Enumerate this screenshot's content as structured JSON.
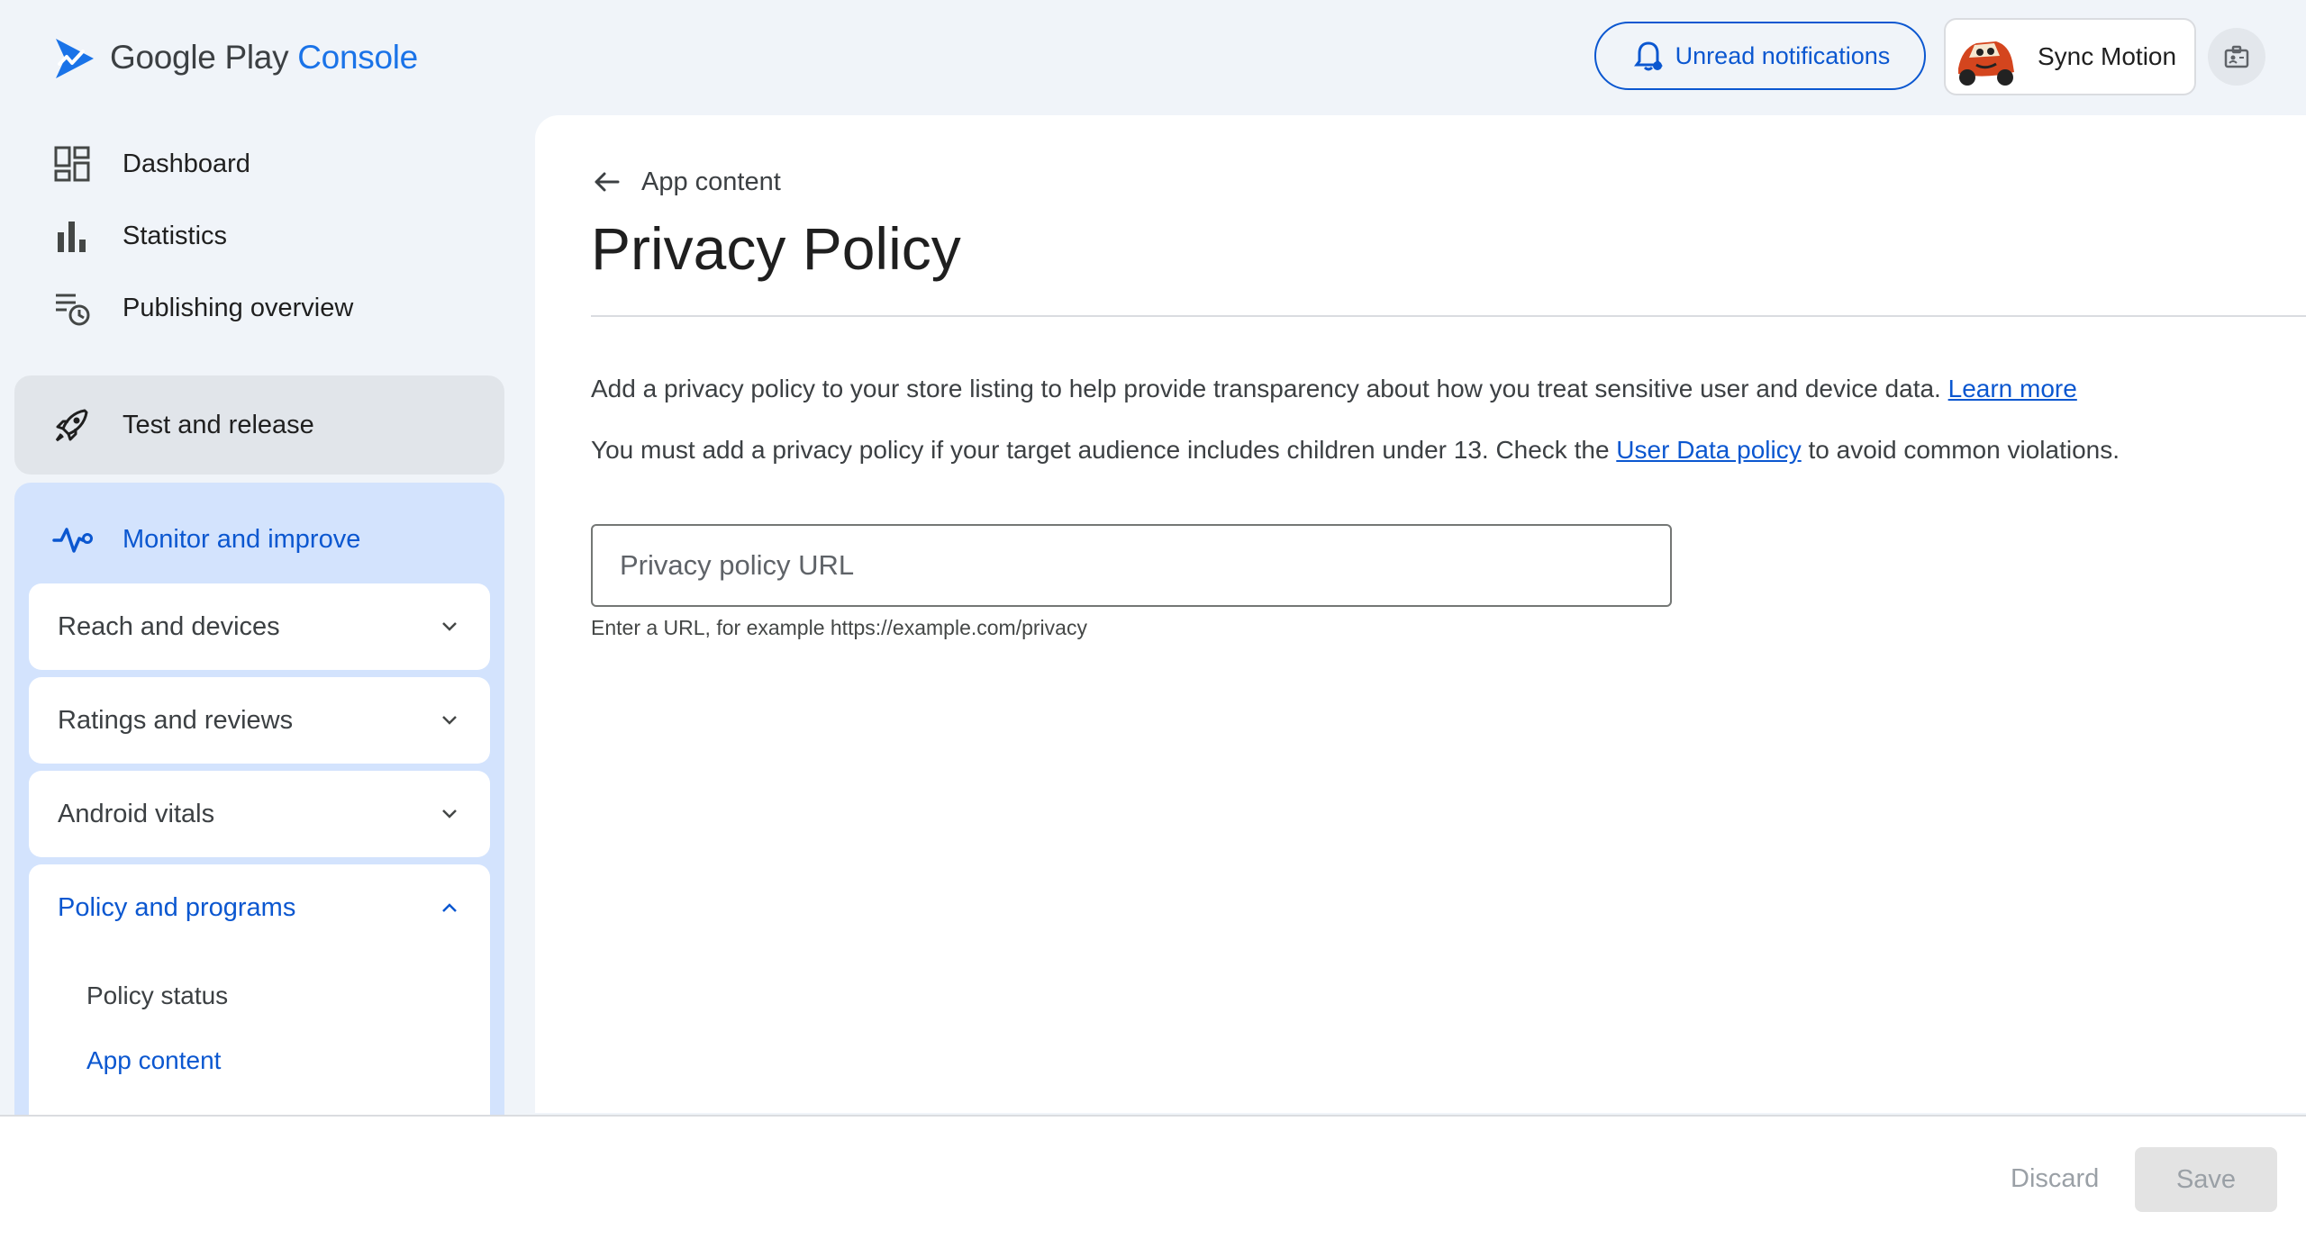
{
  "brand": {
    "name_part1": "Google Play",
    "name_part2": "Console"
  },
  "header": {
    "notifications_label": "Unread notifications",
    "account_name": "Sync Motion"
  },
  "sidebar": {
    "top_items": [
      {
        "label": "Dashboard",
        "icon": "dashboard-icon"
      },
      {
        "label": "Statistics",
        "icon": "bar-chart-icon"
      },
      {
        "label": "Publishing overview",
        "icon": "publishing-overview-icon"
      }
    ],
    "test_release": {
      "label": "Test and release",
      "icon": "rocket-icon"
    },
    "monitor": {
      "label": "Monitor and improve",
      "icon": "monitor-pulse-icon",
      "groups": [
        {
          "label": "Reach and devices",
          "expanded": false
        },
        {
          "label": "Ratings and reviews",
          "expanded": false
        },
        {
          "label": "Android vitals",
          "expanded": false
        },
        {
          "label": "Policy and programs",
          "expanded": true
        }
      ],
      "policy_items": [
        {
          "label": "Policy status",
          "active": false
        },
        {
          "label": "App content",
          "active": true
        }
      ]
    }
  },
  "main": {
    "back_label": "App content",
    "title": "Privacy Policy",
    "description1": "Add a privacy policy to your store listing to help provide transparency about how you treat sensitive user and device data.",
    "learn_more": "Learn more",
    "description2_pre": "You must add a privacy policy if your target audience includes children under 13. Check the",
    "user_data_policy": "User Data policy",
    "description2_post": "to avoid common violations.",
    "url_field": {
      "placeholder": "Privacy policy URL",
      "value": ""
    },
    "url_helper": "Enter a URL, for example https://example.com/privacy"
  },
  "footer": {
    "discard_label": "Discard",
    "save_label": "Save"
  },
  "colors": {
    "accent": "#0b57d0",
    "sidebar_active_bg": "#d3e3fd",
    "page_bg": "#f0f4f9"
  }
}
